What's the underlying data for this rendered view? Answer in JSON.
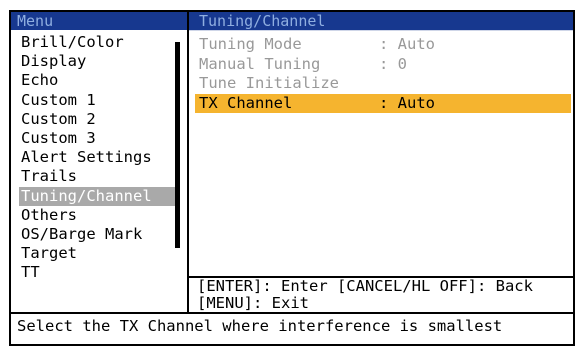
{
  "menu": {
    "title": "Menu",
    "items": [
      {
        "label": "Brill/Color"
      },
      {
        "label": "Display"
      },
      {
        "label": "Echo"
      },
      {
        "label": "Custom 1"
      },
      {
        "label": "Custom 2"
      },
      {
        "label": "Custom 3"
      },
      {
        "label": "Alert Settings"
      },
      {
        "label": "Trails"
      },
      {
        "label": "Tuning/Channel"
      },
      {
        "label": "Others"
      },
      {
        "label": "OS/Barge Mark"
      },
      {
        "label": "Target"
      },
      {
        "label": "TT"
      }
    ],
    "selected_index": 8
  },
  "panel": {
    "title": "Tuning/Channel",
    "rows": [
      {
        "label": "Tuning Mode",
        "value": ": Auto"
      },
      {
        "label": "Manual Tuning",
        "value": ": 0"
      },
      {
        "label": "Tune Initialize",
        "value": ""
      },
      {
        "label": "TX Channel",
        "value": ": Auto"
      }
    ],
    "help_line1": "[ENTER]: Enter [CANCEL/HL OFF]: Back",
    "help_line2": "[MENU]: Exit"
  },
  "status": {
    "text": "Select the TX Channel where interference is smallest"
  },
  "colors": {
    "title_bar": "#17388f",
    "title_text": "#8faee0",
    "highlight": "#f5b42f",
    "selected_menu": "#a9a9a9",
    "disabled_text": "#999999"
  }
}
